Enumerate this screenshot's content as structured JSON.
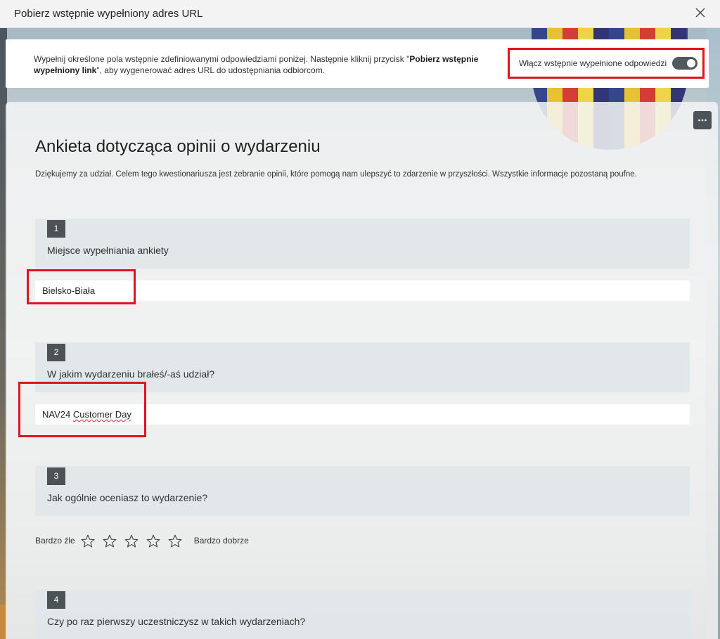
{
  "window": {
    "title": "Pobierz wstępnie wypełniony adres URL",
    "close_icon": "close-icon"
  },
  "banner": {
    "text_before": "Wypełnij określone pola wstępnie zdefiniowanymi odpowiedziami poniżej. Następnie kliknij przycisk \"",
    "text_bold": "Pobierz wstępnie wypełniony link",
    "text_after": "\", aby wygenerować adres URL do udostępniania odbiorcom.",
    "toggle_label": "Włącz wstępnie wypełnione odpowiedzi",
    "toggle_on": true
  },
  "form": {
    "more_label": "···",
    "title": "Ankieta dotycząca opinii o wydarzeniu",
    "description": "Dziękujemy za udział. Celem tego kwestionariusza jest zebranie opinii, które pomogą nam ulepszyć to zdarzenie w przyszłości. Wszystkie informacje pozostaną poufne.",
    "questions": [
      {
        "number": "1",
        "text": "Miejsce wypełniania ankiety",
        "answer": "Bielsko-Biała"
      },
      {
        "number": "2",
        "text": "W jakim wydarzeniu brałeś/-aś udział?",
        "answer_plain": "NAV24 ",
        "answer_spell": "Customer Day"
      },
      {
        "number": "3",
        "text": "Jak ogólnie oceniasz to wydarzenie?",
        "rating_min_label": "Bardzo źle",
        "rating_max_label": "Bardzo dobrze",
        "stars": 5
      },
      {
        "number": "4",
        "text": "Czy po raz pierwszy uczestniczysz w takich wydarzeniach?"
      }
    ]
  },
  "colors": {
    "highlight": "#e0141e",
    "accent_dark": "#4b5357"
  }
}
